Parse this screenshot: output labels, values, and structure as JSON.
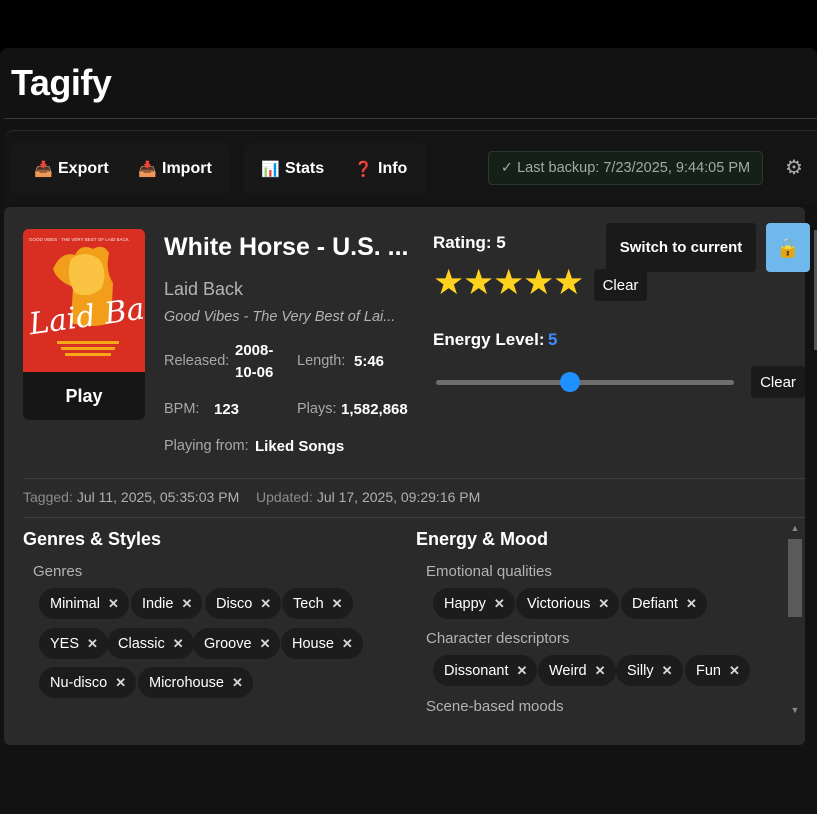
{
  "app": {
    "title": "Tagify"
  },
  "toolbar": {
    "export_label": "Export",
    "import_label": "Import",
    "stats_label": "Stats",
    "info_label": "Info",
    "backup_status": "✓ Last backup: 7/23/2025, 9:44:05 PM"
  },
  "track": {
    "title": "White Horse - U.S. ...",
    "artist": "Laid Back",
    "album": "Good Vibes - The Very Best of Lai...",
    "released_label": "Released:",
    "released_line1": "2008-",
    "released_line2": "10-06",
    "length_label": "Length:",
    "length": "5:46",
    "bpm_label": "BPM:",
    "bpm": "123",
    "plays_label": "Plays:",
    "plays": "1,582,868",
    "playing_from_label": "Playing from:",
    "playing_from": "Liked Songs",
    "play_label": "Play",
    "cover_text": "Laid Back",
    "cover_caption": "GOOD VIBES · THE VERY BEST OF LAID BACK"
  },
  "rating": {
    "label": "Rating: 5",
    "value": 5,
    "max": 5,
    "clear_label": "Clear"
  },
  "energy": {
    "label": "Energy Level:",
    "value": "5",
    "level_fraction": 0.45,
    "clear_label": "Clear"
  },
  "switch_label": "Switch to current",
  "timestamps": {
    "tagged_label": "Tagged:",
    "tagged": "Jul 11, 2025, 05:35:03 PM",
    "updated_label": "Updated:",
    "updated": "Jul 17, 2025, 09:29:16 PM"
  },
  "genres": {
    "title": "Genres & Styles",
    "sub": "Genres",
    "tags": [
      "Minimal",
      "Indie",
      "Disco",
      "Tech",
      "YES",
      "Classic",
      "Groove",
      "House",
      "Nu-disco",
      "Microhouse"
    ]
  },
  "mood": {
    "title": "Energy & Mood",
    "emotional_label": "Emotional qualities",
    "emotional": [
      "Happy",
      "Victorious",
      "Defiant"
    ],
    "character_label": "Character descriptors",
    "character": [
      "Dissonant",
      "Weird",
      "Silly",
      "Fun"
    ],
    "scene_label": "Scene-based moods"
  },
  "colors": {
    "accent": "#1e90ff",
    "star": "#ffd21e",
    "cover": "#d92e22",
    "lock": "#6eb8eb"
  },
  "icons": {
    "export": "inbox-tray-icon",
    "import": "inbox-tray-icon",
    "stats": "bar-chart-icon",
    "info": "question-mark-icon",
    "settings": "gear-icon",
    "lock": "lock-icon",
    "remove": "close-icon"
  }
}
